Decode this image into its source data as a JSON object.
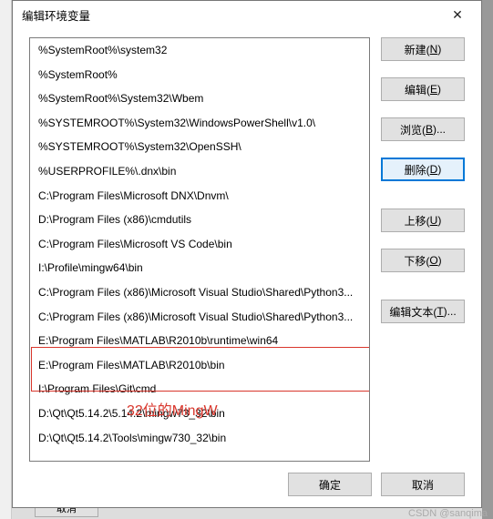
{
  "dialog": {
    "title": "编辑环境变量",
    "close_icon": "✕"
  },
  "entries": [
    "%SystemRoot%\\system32",
    "%SystemRoot%",
    "%SystemRoot%\\System32\\Wbem",
    "%SYSTEMROOT%\\System32\\WindowsPowerShell\\v1.0\\",
    "%SYSTEMROOT%\\System32\\OpenSSH\\",
    "%USERPROFILE%\\.dnx\\bin",
    "C:\\Program Files\\Microsoft DNX\\Dnvm\\",
    "D:\\Program Files (x86)\\cmdutils",
    "C:\\Program Files\\Microsoft VS Code\\bin",
    "I:\\Profile\\mingw64\\bin",
    "C:\\Program Files (x86)\\Microsoft Visual Studio\\Shared\\Python3...",
    "C:\\Program Files (x86)\\Microsoft Visual Studio\\Shared\\Python3...",
    "E:\\Program Files\\MATLAB\\R2010b\\runtime\\win64",
    "E:\\Program Files\\MATLAB\\R2010b\\bin",
    "I:\\Program Files\\Git\\cmd",
    "D:\\Qt\\Qt5.14.2\\5.14.2\\mingw73_32\\bin",
    "D:\\Qt\\Qt5.14.2\\Tools\\mingw730_32\\bin"
  ],
  "buttons": {
    "new": {
      "label": "新建(",
      "key": "N",
      "suffix": ")"
    },
    "edit": {
      "label": "编辑(",
      "key": "E",
      "suffix": ")"
    },
    "browse": {
      "label": "浏览(",
      "key": "B",
      "suffix": ")..."
    },
    "delete": {
      "label": "删除(",
      "key": "D",
      "suffix": ")"
    },
    "up": {
      "label": "上移(",
      "key": "U",
      "suffix": ")"
    },
    "down": {
      "label": "下移(",
      "key": "O",
      "suffix": ")"
    },
    "edit_text": {
      "label": "编辑文本(",
      "key": "T",
      "suffix": ")..."
    },
    "ok": "确定",
    "cancel": "取消"
  },
  "annotation": "32位的MingW",
  "bg_button": "取消",
  "watermark": "CSDN @sanqima"
}
